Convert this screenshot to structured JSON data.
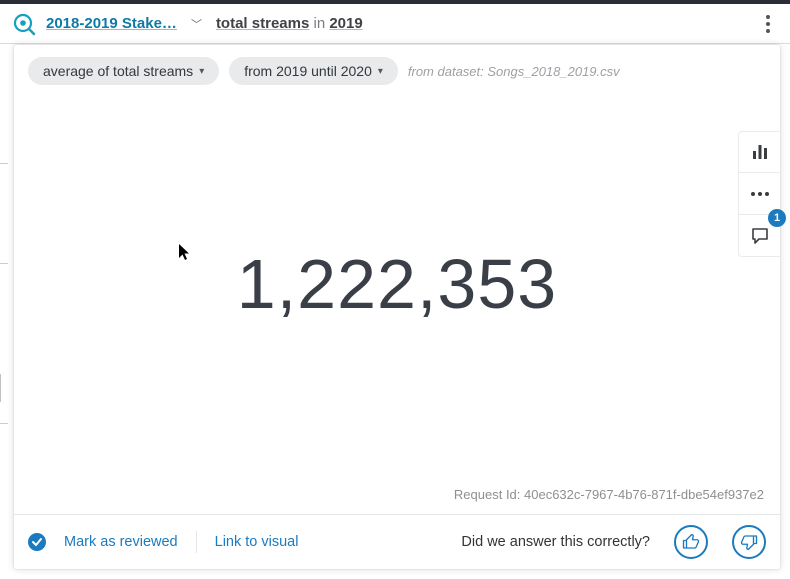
{
  "header": {
    "title": "2018-2019 Stake…",
    "query_metric": "total streams",
    "query_joiner": " in ",
    "query_year": "2019"
  },
  "filters": {
    "pill1": "average of total streams",
    "pill2": "from 2019 until 2020",
    "dataset_prefix": "from dataset: ",
    "dataset_name": "Songs_2018_2019.csv"
  },
  "vactions": {
    "comment_badge": "1"
  },
  "kpi": {
    "value": "1,222,353"
  },
  "request": {
    "label": "Request Id: ",
    "id": "40ec632c-7967-4b76-871f-dbe54ef937e2"
  },
  "footer": {
    "mark_reviewed": "Mark as reviewed",
    "link_visual": "Link to visual",
    "feedback_question": "Did we answer this correctly?"
  }
}
